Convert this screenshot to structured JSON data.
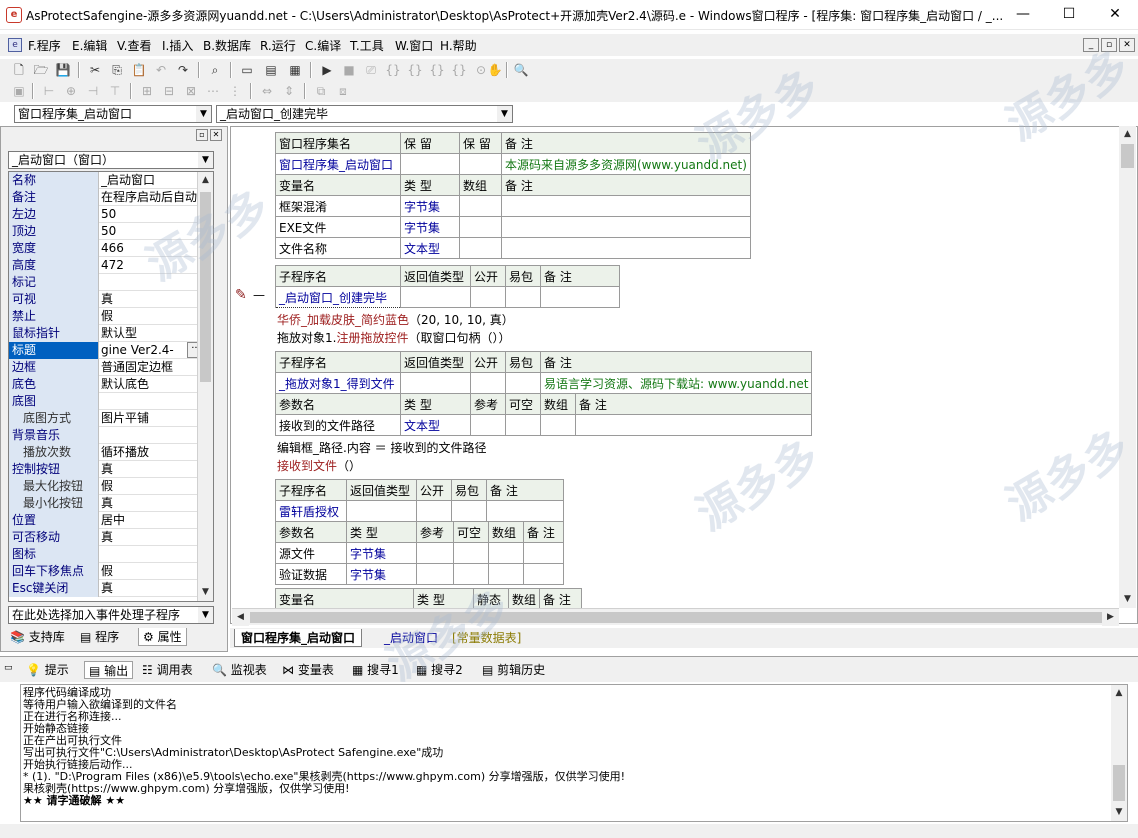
{
  "window": {
    "title": "AsProtectSafengine-源多多资源网yuandd.net - C:\\Users\\Administrator\\Desktop\\AsProtect+开源加壳Ver2.4\\源码.e - Windows窗口程序 - [程序集: 窗口程序集_启动窗口 / _...",
    "minimize": "—",
    "maximize": "☐",
    "close": "✕"
  },
  "menu": [
    "F.程序",
    "E.编辑",
    "V.查看",
    "I.插入",
    "B.数据库",
    "R.运行",
    "C.编译",
    "T.工具",
    "W.窗口",
    "H.帮助"
  ],
  "mdi_buttons": [
    "_",
    "▫",
    "✕"
  ],
  "combos": {
    "assembly": "窗口程序集_启动窗口",
    "method": "_启动窗口_创建完毕",
    "component": "_启动窗口（窗口）",
    "event": "在此处选择加入事件处理子程序"
  },
  "properties": [
    {
      "name": "名称",
      "value": "_启动窗口"
    },
    {
      "name": "备注",
      "value": "在程序启动后自动"
    },
    {
      "name": "左边",
      "value": "50"
    },
    {
      "name": "顶边",
      "value": "50"
    },
    {
      "name": "宽度",
      "value": "466"
    },
    {
      "name": "高度",
      "value": "472"
    },
    {
      "name": "标记",
      "value": ""
    },
    {
      "name": "可视",
      "value": "真"
    },
    {
      "name": "禁止",
      "value": "假"
    },
    {
      "name": "鼠标指针",
      "value": "默认型"
    },
    {
      "name": "标题",
      "value": "gine Ver2.4-"
    },
    {
      "name": "边框",
      "value": "普通固定边框"
    },
    {
      "name": "底色",
      "value": "默认底色"
    },
    {
      "name": "底图",
      "value": ""
    },
    {
      "name": "底图方式",
      "value": "图片平铺"
    },
    {
      "name": "背景音乐",
      "value": ""
    },
    {
      "name": "播放次数",
      "value": "循环播放"
    },
    {
      "name": "控制按钮",
      "value": "真"
    },
    {
      "name": "最大化按钮",
      "value": "假"
    },
    {
      "name": "最小化按钮",
      "value": "真"
    },
    {
      "name": "位置",
      "value": "居中"
    },
    {
      "name": "可否移动",
      "value": "真"
    },
    {
      "name": "图标",
      "value": ""
    },
    {
      "name": "回车下移焦点",
      "value": "假"
    },
    {
      "name": "Esc键关闭",
      "value": "真"
    }
  ],
  "left_tabs": [
    "支持库",
    "程序",
    "属性"
  ],
  "assembly_table": {
    "headers": [
      "窗口程序集名",
      "保 留",
      "保 留",
      "备 注"
    ],
    "row": [
      "窗口程序集_启动窗口",
      "",
      "",
      "本源码来自源多多资源网(www.yuandd.net)"
    ],
    "var_headers": [
      "变量名",
      "类 型",
      "数组",
      "备 注"
    ],
    "vars": [
      [
        "框架混淆",
        "字节集",
        "",
        ""
      ],
      [
        "EXE文件",
        "字节集",
        "",
        ""
      ],
      [
        "文件名称",
        "文本型",
        "",
        ""
      ]
    ]
  },
  "sub1": {
    "headers": [
      "子程序名",
      "返回值类型",
      "公开",
      "易包",
      "备 注"
    ],
    "row": [
      "_启动窗口_创建完毕",
      "",
      "",
      "",
      ""
    ]
  },
  "code1": {
    "line1_func": "华侨_加载皮肤_简约蓝色",
    "line1_args": "（20, 10, 10, 真）",
    "line2_obj": "拖放对象1.",
    "line2_func": "注册拖放控件",
    "line2_args": "（取窗口句柄（））"
  },
  "sub2": {
    "headers": [
      "子程序名",
      "返回值类型",
      "公开",
      "易包",
      "备 注"
    ],
    "row": [
      "_拖放对象1_得到文件",
      "",
      "",
      "",
      "易语言学习资源、源码下载站: www.yuandd.net"
    ],
    "param_headers": [
      "参数名",
      "类 型",
      "参考",
      "可空",
      "数组",
      "备 注"
    ],
    "params": [
      [
        "接收到的文件路径",
        "文本型",
        "",
        "",
        "",
        ""
      ]
    ]
  },
  "code2": {
    "line1": "编辑框_路径.内容 ＝ 接收到的文件路径",
    "line2_func": "接收到文件",
    "line2_args": "（）"
  },
  "sub3": {
    "headers": [
      "子程序名",
      "返回值类型",
      "公开",
      "易包",
      "备 注"
    ],
    "row": [
      "雷轩盾授权",
      "",
      "",
      "",
      ""
    ],
    "param_headers": [
      "参数名",
      "类 型",
      "参考",
      "可空",
      "数组",
      "备 注"
    ],
    "params": [
      [
        "源文件",
        "字节集",
        "",
        "",
        "",
        ""
      ],
      [
        "验证数据",
        "字节集",
        "",
        "",
        "",
        ""
      ]
    ]
  },
  "local_vars": {
    "headers": [
      "变量名",
      "类 型",
      "静态",
      "数组",
      "备 注"
    ]
  },
  "editor_tabs": [
    "窗口程序集_启动窗口",
    "_启动窗口",
    "[常量数据表]"
  ],
  "bottom_tabs": [
    "提示",
    "输出",
    "调用表",
    "监视表",
    "变量表",
    "搜寻1",
    "搜寻2",
    "剪辑历史"
  ],
  "output_lines": [
    "程序代码编译成功",
    "等待用户输入欲编译到的文件名",
    "正在进行名称连接...",
    "开始静态链接",
    "正在产出可执行文件",
    "写出可执行文件\"C:\\Users\\Administrator\\Desktop\\AsProtect Safengine.exe\"成功",
    "开始执行链接后动作...",
    "* (1). \"D:\\Program Files (x86)\\e5.9\\tools\\echo.exe\"果核剥壳(https://www.ghpym.com) 分享增强版，仅供学习使用!",
    "果核剥壳(https://www.ghpym.com) 分享增强版，仅供学习使用!",
    "★★ 请字通破解 ★★"
  ],
  "watermark": "源多多"
}
